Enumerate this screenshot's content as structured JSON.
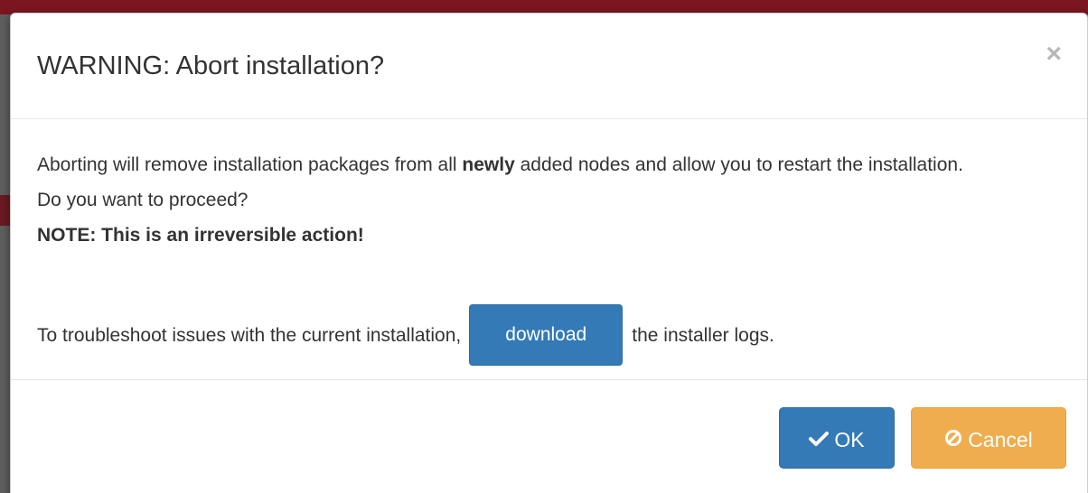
{
  "modal": {
    "title": "WARNING: Abort installation?",
    "close_symbol": "×",
    "body": {
      "line1_before": "Aborting will remove installation packages from all ",
      "line1_bold": "newly",
      "line1_after": " added nodes and allow you to restart the installation.",
      "question": "Do you want to proceed?",
      "note": "NOTE: This is an irreversible action!",
      "troubleshoot_before": "To troubleshoot issues with the current installation,",
      "download_label": "download",
      "troubleshoot_after": "the installer logs."
    },
    "footer": {
      "ok_label": "OK",
      "ok_icon": "checkmark-icon",
      "cancel_label": "Cancel",
      "cancel_icon": "ban-icon"
    }
  },
  "colors": {
    "primary": "#337ab7",
    "warning": "#f0ad4e",
    "header_bar": "#7a1620"
  }
}
